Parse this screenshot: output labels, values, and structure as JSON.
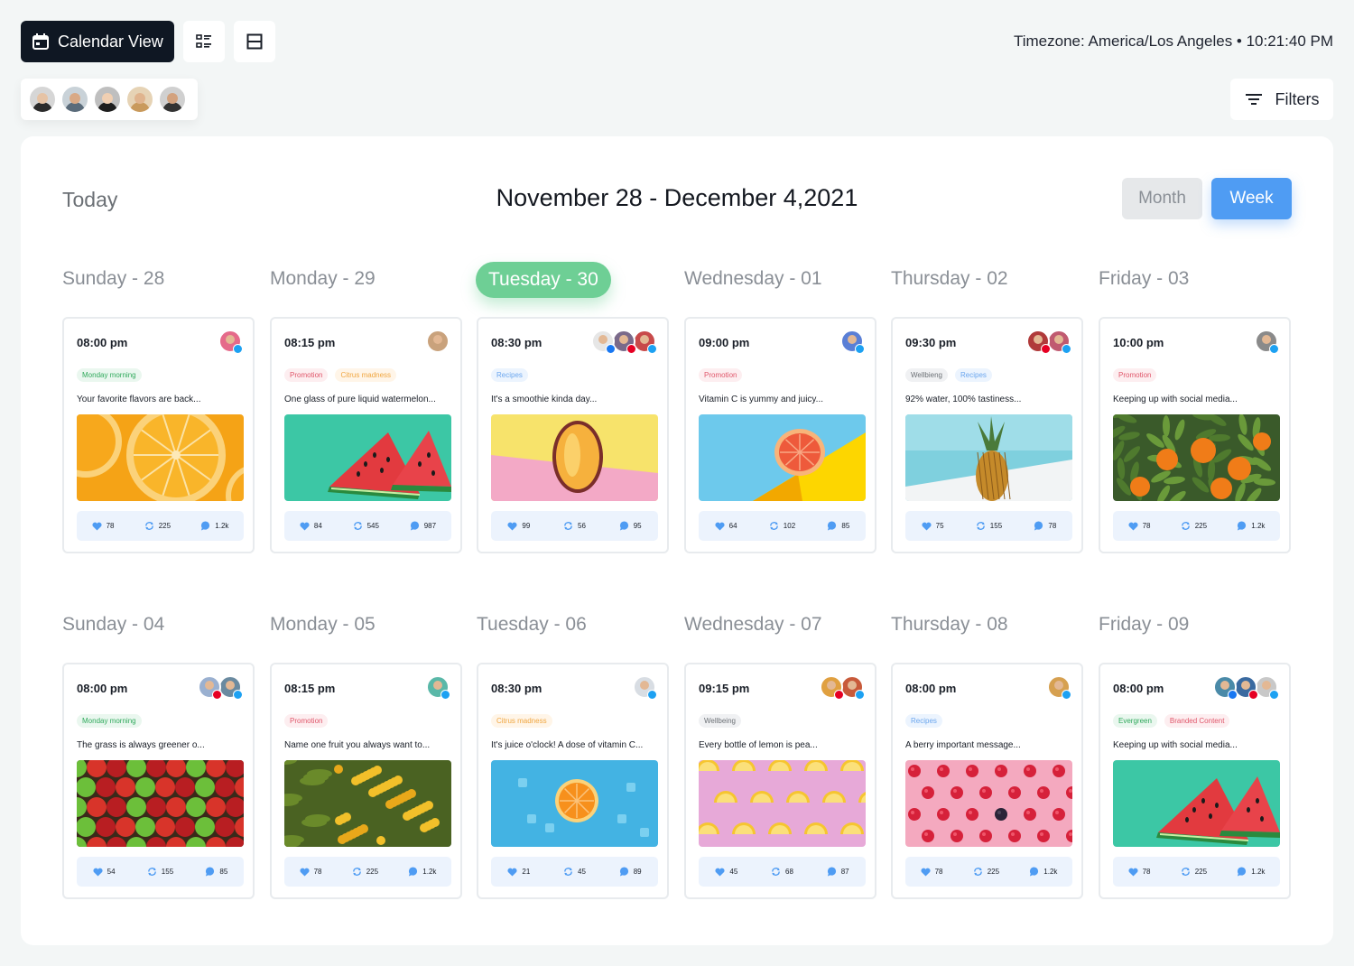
{
  "toolbar": {
    "calendar_view_label": "Calendar View",
    "timezone": "Timezone: America/Los Angeles • 10:21:40 PM",
    "filters_label": "Filters"
  },
  "team_avatars": [
    {
      "skin": "#e6c3a5",
      "shirt": "#2b2b2b",
      "bg": "#d6d6d6"
    },
    {
      "skin": "#d9a985",
      "shirt": "#5a6b7a",
      "bg": "#c9d2d8"
    },
    {
      "skin": "#f0cfb2",
      "shirt": "#1e1e1e",
      "bg": "#bfbfbf"
    },
    {
      "skin": "#e0b48e",
      "shirt": "#c99a5c",
      "bg": "#e6d3b5"
    },
    {
      "skin": "#d3a27e",
      "shirt": "#333333",
      "bg": "#d0d0d0"
    }
  ],
  "panel": {
    "today_label": "Today",
    "date_range": "November 28 - December 4,2021",
    "month_label": "Month",
    "week_label": "Week"
  },
  "colors": {
    "accent": "#4f9cf3",
    "today_pill": "#6ecf95",
    "twitter": "#1da1f2",
    "pinterest": "#e60023",
    "facebook": "#1877f2"
  },
  "weeks": [
    {
      "days": [
        {
          "label": "Sunday - 28",
          "today": false,
          "post": {
            "time": "08:00 pm",
            "tags": [
              {
                "text": "Monday morning",
                "color": "green"
              }
            ],
            "text": "Your favorite flavors are back...",
            "image": "orange-slices",
            "likes": "78",
            "shares": "225",
            "comments": "1.2k",
            "avatars": [
              {
                "bg": "#e56a8a",
                "social": "twitter"
              }
            ]
          }
        },
        {
          "label": "Monday - 29",
          "today": false,
          "post": {
            "time": "08:15 pm",
            "tags": [
              {
                "text": "Promotion",
                "color": "pink"
              },
              {
                "text": "Citrus madness",
                "color": "orange"
              }
            ],
            "text": "One glass of pure liquid watermelon...",
            "image": "watermelon",
            "likes": "84",
            "shares": "545",
            "comments": "987",
            "avatars": [
              {
                "bg": "#c9a27c",
                "social": "none"
              }
            ]
          }
        },
        {
          "label": "Tuesday - 30",
          "today": true,
          "post": {
            "time": "08:30 pm",
            "tags": [
              {
                "text": "Recipes",
                "color": "blue"
              }
            ],
            "text": "It's a smoothie kinda day...",
            "image": "mango",
            "likes": "99",
            "shares": "56",
            "comments": "95",
            "avatars": [
              {
                "bg": "#e6e6e6",
                "social": "facebook"
              },
              {
                "bg": "#7a6a8a",
                "social": "pinterest"
              },
              {
                "bg": "#c84a4a",
                "social": "twitter"
              }
            ]
          }
        },
        {
          "label": "Wednesday - 01",
          "today": false,
          "post": {
            "time": "09:00 pm",
            "tags": [
              {
                "text": "Promotion",
                "color": "pink"
              }
            ],
            "text": "Vitamin C is yummy and juicy...",
            "image": "grapefruit",
            "likes": "64",
            "shares": "102",
            "comments": "85",
            "avatars": [
              {
                "bg": "#5a7fd6",
                "social": "twitter"
              }
            ]
          }
        },
        {
          "label": "Thursday - 02",
          "today": false,
          "post": {
            "time": "09:30 pm",
            "tags": [
              {
                "text": "Wellbieng",
                "color": "gray"
              },
              {
                "text": "Recipes",
                "color": "blue"
              }
            ],
            "text": "92% water, 100% tastiness...",
            "image": "pineapple",
            "likes": "75",
            "shares": "155",
            "comments": "78",
            "avatars": [
              {
                "bg": "#b03a3a",
                "social": "pinterest"
              },
              {
                "bg": "#c05a70",
                "social": "twitter"
              }
            ]
          }
        },
        {
          "label": "Friday - 03",
          "today": false,
          "post": {
            "time": "10:00 pm",
            "tags": [
              {
                "text": "Promotion",
                "color": "pink"
              }
            ],
            "text": "Keeping up with social media...",
            "image": "orange-tree",
            "likes": "78",
            "shares": "225",
            "comments": "1.2k",
            "avatars": [
              {
                "bg": "#8a8a8a",
                "social": "twitter"
              }
            ]
          }
        }
      ]
    },
    {
      "days": [
        {
          "label": "Sunday - 04",
          "today": false,
          "post": {
            "time": "08:00 pm",
            "tags": [
              {
                "text": "Monday morning",
                "color": "green"
              }
            ],
            "text": "The grass is always greener o...",
            "image": "apples",
            "likes": "54",
            "shares": "155",
            "comments": "85",
            "avatars": [
              {
                "bg": "#9ab0d0",
                "social": "pinterest"
              },
              {
                "bg": "#6a8aa0",
                "social": "twitter"
              }
            ]
          }
        },
        {
          "label": "Monday - 05",
          "today": false,
          "post": {
            "time": "08:15 pm",
            "tags": [
              {
                "text": "Promotion",
                "color": "pink"
              }
            ],
            "text": "Name one fruit you always want to...",
            "image": "yellow-berries",
            "likes": "78",
            "shares": "225",
            "comments": "1.2k",
            "avatars": [
              {
                "bg": "#5ab8a8",
                "social": "twitter"
              }
            ]
          }
        },
        {
          "label": "Tuesday - 06",
          "today": false,
          "post": {
            "time": "08:30 pm",
            "tags": [
              {
                "text": "Citrus madness",
                "color": "orange"
              }
            ],
            "text": "It's juice o'clock! A dose of vitamin C...",
            "image": "orange-blue",
            "likes": "21",
            "shares": "45",
            "comments": "89",
            "avatars": [
              {
                "bg": "#d8dde3",
                "social": "twitter"
              }
            ]
          }
        },
        {
          "label": "Wednesday - 07",
          "today": false,
          "post": {
            "time": "09:15 pm",
            "tags": [
              {
                "text": "Wellbeing",
                "color": "gray"
              }
            ],
            "text": "Every bottle of lemon is pea...",
            "image": "lemons-pink",
            "likes": "45",
            "shares": "68",
            "comments": "87",
            "avatars": [
              {
                "bg": "#e0a040",
                "social": "pinterest"
              },
              {
                "bg": "#c85a3a",
                "social": "twitter"
              }
            ]
          }
        },
        {
          "label": "Thursday - 08",
          "today": false,
          "post": {
            "time": "08:00 pm",
            "tags": [
              {
                "text": "Recipes",
                "color": "blue"
              }
            ],
            "text": "A berry important message...",
            "image": "raspberries",
            "likes": "78",
            "shares": "225",
            "comments": "1.2k",
            "avatars": [
              {
                "bg": "#d6a050",
                "social": "twitter"
              }
            ]
          }
        },
        {
          "label": "Friday - 09",
          "today": false,
          "post": {
            "time": "08:00 pm",
            "tags": [
              {
                "text": "Evergreen",
                "color": "green"
              },
              {
                "text": "Branded Content",
                "color": "pink"
              }
            ],
            "text": "Keeping up with social media...",
            "image": "watermelon",
            "likes": "78",
            "shares": "225",
            "comments": "1.2k",
            "avatars": [
              {
                "bg": "#4a8aa8",
                "social": "facebook"
              },
              {
                "bg": "#3a6aa0",
                "social": "pinterest"
              },
              {
                "bg": "#c8c8c8",
                "social": "twitter"
              }
            ]
          }
        }
      ]
    }
  ]
}
